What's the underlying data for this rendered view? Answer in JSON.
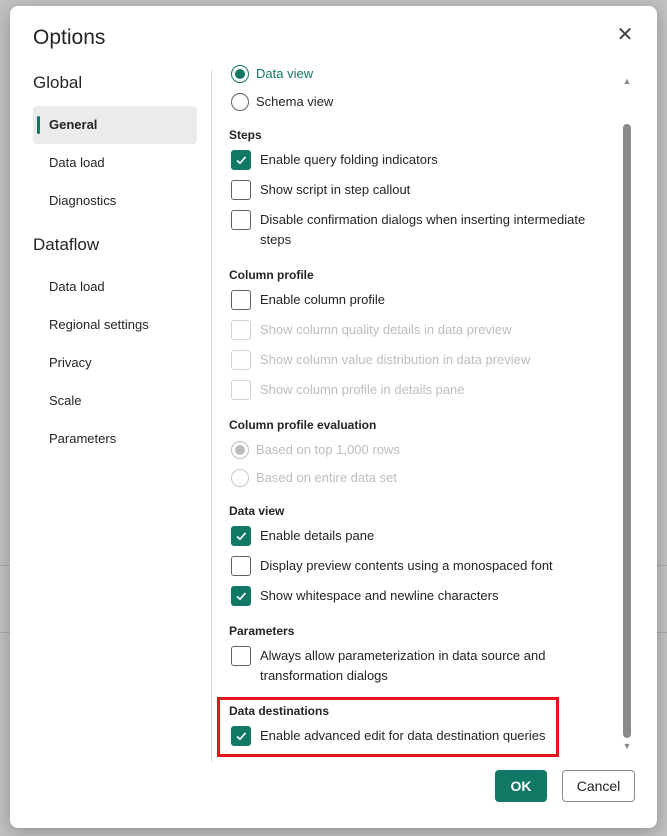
{
  "dialog": {
    "title": "Options",
    "close_glyph": "✕"
  },
  "nav": {
    "sections": [
      {
        "label": "Global",
        "items": [
          {
            "label": "General",
            "active": true
          },
          {
            "label": "Data load",
            "active": false
          },
          {
            "label": "Diagnostics",
            "active": false
          }
        ]
      },
      {
        "label": "Dataflow",
        "items": [
          {
            "label": "Data load",
            "active": false
          },
          {
            "label": "Regional settings",
            "active": false
          },
          {
            "label": "Privacy",
            "active": false
          },
          {
            "label": "Scale",
            "active": false
          },
          {
            "label": "Parameters",
            "active": false
          }
        ]
      }
    ]
  },
  "content": {
    "view_radio": [
      {
        "label": "Data view",
        "selected": true
      },
      {
        "label": "Schema view",
        "selected": false
      }
    ],
    "steps": {
      "title": "Steps",
      "options": [
        {
          "label": "Enable query folding indicators",
          "checked": true,
          "disabled": false
        },
        {
          "label": "Show script in step callout",
          "checked": false,
          "disabled": false
        },
        {
          "label": "Disable confirmation dialogs when inserting intermediate steps",
          "checked": false,
          "disabled": false
        }
      ]
    },
    "column_profile": {
      "title": "Column profile",
      "options": [
        {
          "label": "Enable column profile",
          "checked": false,
          "disabled": false
        },
        {
          "label": "Show column quality details in data preview",
          "checked": false,
          "disabled": true
        },
        {
          "label": "Show column value distribution in data preview",
          "checked": false,
          "disabled": true
        },
        {
          "label": "Show column profile in details pane",
          "checked": false,
          "disabled": true
        }
      ]
    },
    "column_profile_evaluation": {
      "title": "Column profile evaluation",
      "options": [
        {
          "label": "Based on top 1,000 rows",
          "selected": true,
          "disabled": true
        },
        {
          "label": "Based on entire data set",
          "selected": false,
          "disabled": true
        }
      ]
    },
    "data_view": {
      "title": "Data view",
      "options": [
        {
          "label": "Enable details pane",
          "checked": true,
          "disabled": false
        },
        {
          "label": "Display preview contents using a monospaced font",
          "checked": false,
          "disabled": false
        },
        {
          "label": "Show whitespace and newline characters",
          "checked": true,
          "disabled": false
        }
      ]
    },
    "parameters": {
      "title": "Parameters",
      "options": [
        {
          "label": "Always allow parameterization in data source and transformation dialogs",
          "checked": false,
          "disabled": false
        }
      ]
    },
    "data_destinations": {
      "title": "Data destinations",
      "options": [
        {
          "label": "Enable advanced edit for data destination queries",
          "checked": true,
          "disabled": false
        }
      ]
    }
  },
  "footer": {
    "ok_label": "OK",
    "cancel_label": "Cancel"
  },
  "colors": {
    "accent": "#117865",
    "highlight_border": "#e3141b"
  }
}
